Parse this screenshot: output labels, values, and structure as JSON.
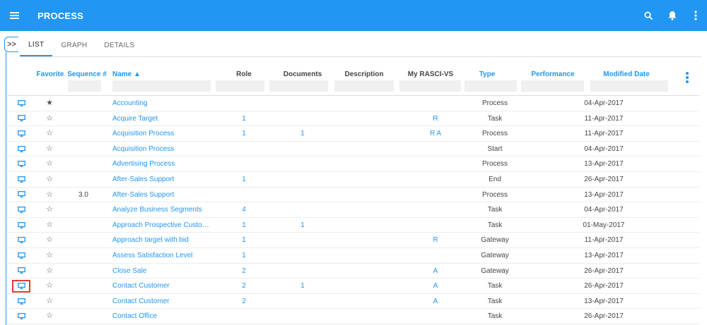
{
  "app": {
    "title": "PROCESS"
  },
  "tabs": [
    {
      "label": "LIST",
      "active": true
    },
    {
      "label": "GRAPH",
      "active": false
    },
    {
      "label": "DETAILS",
      "active": false
    }
  ],
  "expand": {
    "label": ">>"
  },
  "columns": {
    "favorite": "Favorite",
    "sequence": "Sequence #",
    "name": "Name ▲",
    "role": "Role",
    "documents": "Documents",
    "description": "Description",
    "rasci": "My RASCI-VS",
    "type": "Type",
    "performance": "Performance",
    "modified": "Modified Date"
  },
  "icons": {
    "menu": "menu-icon",
    "search": "search-icon",
    "bell": "bell-icon",
    "more": "more-vert-icon",
    "row": "monitor-icon",
    "fav_filled": "star-filled-icon",
    "fav_empty": "star-outline-icon"
  },
  "colors": {
    "primary": "#2196f3",
    "highlight": "#e53935"
  },
  "rows": [
    {
      "fav": "★",
      "seq": "",
      "name": "Accounting",
      "role": "",
      "docs": "",
      "rasci": "",
      "type": "Process",
      "date": "04-Apr-2017"
    },
    {
      "fav": "☆",
      "seq": "",
      "name": "Acquire Target",
      "role": "1",
      "docs": "",
      "rasci": "R",
      "type": "Task",
      "date": "11-Apr-2017"
    },
    {
      "fav": "☆",
      "seq": "",
      "name": "Acquisition Process",
      "role": "1",
      "docs": "1",
      "rasci": "R A",
      "type": "Process",
      "date": "11-Apr-2017"
    },
    {
      "fav": "☆",
      "seq": "",
      "name": "Acquisition Process",
      "role": "",
      "docs": "",
      "rasci": "",
      "type": "Start",
      "date": "04-Apr-2017"
    },
    {
      "fav": "☆",
      "seq": "",
      "name": "Advertising Process",
      "role": "",
      "docs": "",
      "rasci": "",
      "type": "Process",
      "date": "13-Apr-2017"
    },
    {
      "fav": "☆",
      "seq": "",
      "name": "After-Sales Support",
      "role": "1",
      "docs": "",
      "rasci": "",
      "type": "End",
      "date": "26-Apr-2017"
    },
    {
      "fav": "☆",
      "seq": "3.0",
      "name": "After-Sales Support",
      "role": "",
      "docs": "",
      "rasci": "",
      "type": "Process",
      "date": "13-Apr-2017"
    },
    {
      "fav": "☆",
      "seq": "",
      "name": "Analyze Business Segments",
      "role": "4",
      "docs": "",
      "rasci": "",
      "type": "Task",
      "date": "04-Apr-2017"
    },
    {
      "fav": "☆",
      "seq": "",
      "name": "Approach Prospective Custom...",
      "role": "1",
      "docs": "1",
      "rasci": "",
      "type": "Task",
      "date": "01-May-2017"
    },
    {
      "fav": "☆",
      "seq": "",
      "name": "Approach target with bid",
      "role": "1",
      "docs": "",
      "rasci": "R",
      "type": "Gateway",
      "date": "11-Apr-2017"
    },
    {
      "fav": "☆",
      "seq": "",
      "name": "Assess Satisfaction Level",
      "role": "1",
      "docs": "",
      "rasci": "",
      "type": "Gateway",
      "date": "13-Apr-2017"
    },
    {
      "fav": "☆",
      "seq": "",
      "name": "Close Sale",
      "role": "2",
      "docs": "",
      "rasci": "A",
      "type": "Gateway",
      "date": "26-Apr-2017"
    },
    {
      "fav": "☆",
      "seq": "",
      "name": "Contact Customer",
      "role": "2",
      "docs": "1",
      "rasci": "A",
      "type": "Task",
      "date": "26-Apr-2017",
      "highlighted": true
    },
    {
      "fav": "☆",
      "seq": "",
      "name": "Contact Customer",
      "role": "2",
      "docs": "",
      "rasci": "A",
      "type": "Task",
      "date": "13-Apr-2017"
    },
    {
      "fav": "☆",
      "seq": "",
      "name": "Contact Office",
      "role": "",
      "docs": "",
      "rasci": "",
      "type": "Task",
      "date": "26-Apr-2017"
    }
  ]
}
